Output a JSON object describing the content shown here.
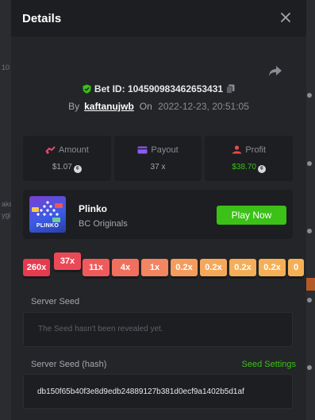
{
  "background": {
    "fragments": [
      "10",
      "ake",
      "ygil"
    ]
  },
  "modal": {
    "title": "Details"
  },
  "bet": {
    "id_label": "Bet ID:",
    "id_value": "104590983462653431",
    "by_label": "By",
    "username": "kaftanujwb",
    "on_label": "On",
    "datetime": "2022-12-23, 20:51:05"
  },
  "stats": [
    {
      "label": "Amount",
      "value": "$1.07",
      "icon": "coins-icon"
    },
    {
      "label": "Payout",
      "value": "37 x",
      "icon": "card-icon"
    },
    {
      "label": "Profit",
      "value": "$38.70",
      "icon": "profit-icon"
    }
  ],
  "game": {
    "name": "Plinko",
    "provider": "BC Originals",
    "play_label": "Play Now",
    "thumb_text": "PLINKO"
  },
  "multipliers": [
    {
      "label": "260x",
      "color": "#e63a4f"
    },
    {
      "label": "37x",
      "color": "#ea4a58"
    },
    {
      "label": "11x",
      "color": "#ef5b5b"
    },
    {
      "label": "4x",
      "color": "#f1705d"
    },
    {
      "label": "1x",
      "color": "#f38560"
    },
    {
      "label": "0.2x",
      "color": "#f49c5d"
    },
    {
      "label": "0.2x",
      "color": "#f5a85a"
    },
    {
      "label": "0.2x",
      "color": "#f5ad58"
    },
    {
      "label": "0.2x",
      "color": "#f5b057"
    },
    {
      "label": "0",
      "color": "#f5b057"
    }
  ],
  "seeds": {
    "server_seed_label": "Server Seed",
    "server_seed_placeholder": "The Seed hasn't been revealed yet.",
    "hash_label": "Server Seed (hash)",
    "seed_settings_label": "Seed Settings",
    "hash_value": "db150f65b40f3e8d9edb24889127b381d0ecf9a1402b5d1af"
  },
  "colors": {
    "accent_green": "#3bc117",
    "panel": "#1c1e21",
    "modal_bg": "#232528"
  }
}
